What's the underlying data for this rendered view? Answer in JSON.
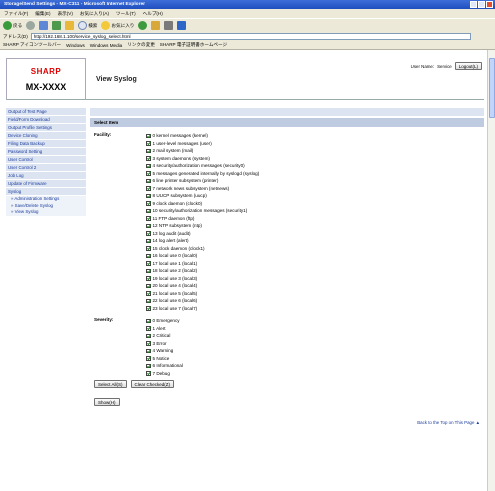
{
  "browser": {
    "title": "Storage/Send Settings - MX-C311 - Microsoft Internet Explorer",
    "menus": [
      "ファイル(F)",
      "編集(E)",
      "表示(V)",
      "お気に入り(A)",
      "ツール(T)",
      "ヘルプ(H)"
    ],
    "toolbar": {
      "back": "戻る",
      "search": "検索",
      "favorites": "お気に入り"
    },
    "address_label": "アドレス(D)",
    "address": "http://192.168.1.100/service_syslog_select.html",
    "favorites": [
      "SHARP アイコンツールバー",
      "Windows",
      "Windows Media",
      "リンクの変更",
      "SHARP 電子証明書ホームページ"
    ]
  },
  "page": {
    "logo": "SHARP",
    "model": "MX-XXXX",
    "title": "View Syslog",
    "user_label": "User Name:",
    "user_name": "Service",
    "logout": "Logout(L)"
  },
  "sidebar": {
    "items": [
      "Output of Test Page",
      "Field/Form Download",
      "Output Profile Settings",
      "Device Cloning",
      "Filing Data Backup",
      "Password Setting",
      "User Control",
      "User Control 2",
      "Job Log",
      "Update of Firmware",
      "Syslog"
    ],
    "subitems": [
      "» Administration Settings",
      "» Save/Delete Syslog",
      "» View Syslog"
    ]
  },
  "main": {
    "section": "Select Item",
    "facility_label": "Facility:",
    "facilities": [
      "0 kernel messages (kernel)",
      "1 user-level messages (user)",
      "2 mail system (mail)",
      "3 system daemons (system)",
      "4 security/authorization messages (security0)",
      "5 messages generated internally by syslogd (syslog)",
      "6 line printer subsystem (printer)",
      "7 network news subsystem (netnews)",
      "8 UUCP subsystem (uucp)",
      "9 clock daemon (clock0)",
      "10 security/authorization messages (security1)",
      "11 FTP daemon (ftp)",
      "12 NTP subsystem (ntp)",
      "13 log audit (audit)",
      "14 log alert (alert)",
      "15 clock daemon (clock1)",
      "16 local use 0 (local0)",
      "17 local use 1 (local1)",
      "18 local use 2 (local2)",
      "19 local use 3 (local3)",
      "20 local use 4 (local4)",
      "21 local use 5 (local5)",
      "22 local use 6 (local6)",
      "23 local use 7 (local7)"
    ],
    "severity_label": "Severity:",
    "severities": [
      "0 Emergency",
      "1 Alert",
      "2 Critical",
      "3 Error",
      "4 Warning",
      "5 Notice",
      "6 Informational",
      "7 Debug"
    ],
    "select_all": "Select All(S)",
    "clear_checked": "Clear Checked(Z)",
    "show": "Show(H)",
    "back_to_top": "Back to the Top on This Page ▲"
  }
}
